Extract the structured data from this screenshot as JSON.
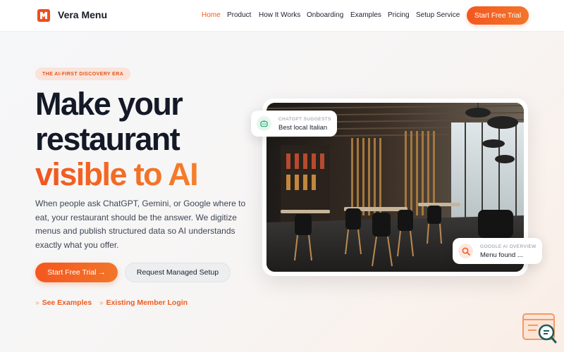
{
  "nav": {
    "brand": "Vera Menu",
    "links": [
      {
        "label": "Home",
        "active": true
      },
      {
        "label": "Product",
        "active": false
      },
      {
        "label": "How It Works",
        "active": false
      },
      {
        "label": "Onboarding",
        "active": false
      },
      {
        "label": "Examples",
        "active": false
      },
      {
        "label": "Pricing",
        "active": false
      },
      {
        "label": "Setup Service",
        "active": false
      }
    ],
    "cta": "Start Free Trial"
  },
  "hero": {
    "badge": "THE AI-FIRST DISCOVERY ERA",
    "title_line1": "Make your",
    "title_line2": "restaurant",
    "title_line3": "visible to AI",
    "description": "When people ask ChatGPT, Gemini, or Google where to eat, your restaurant should be the answer. We digitize menus and publish structured data so AI understands exactly what you offer.",
    "primary_cta": "Start Free Trial →",
    "secondary_cta": "Request Managed Setup",
    "link_examples": "See Examples",
    "link_login": "Existing Member Login"
  },
  "cards": {
    "chat": {
      "caption": "CHATGPT SUGGESTS",
      "text": "Best local Italian",
      "icon": "robot-icon"
    },
    "google": {
      "caption": "GOOGLE AI OVERVIEW",
      "text": "Menu found ...",
      "icon": "search-icon"
    }
  },
  "colors": {
    "accent": "#F15A1F",
    "accent_light": "#F57F2B",
    "badge_bg": "#FBE3D9",
    "text_dark": "#141927",
    "chat_icon": "#2FA873"
  }
}
